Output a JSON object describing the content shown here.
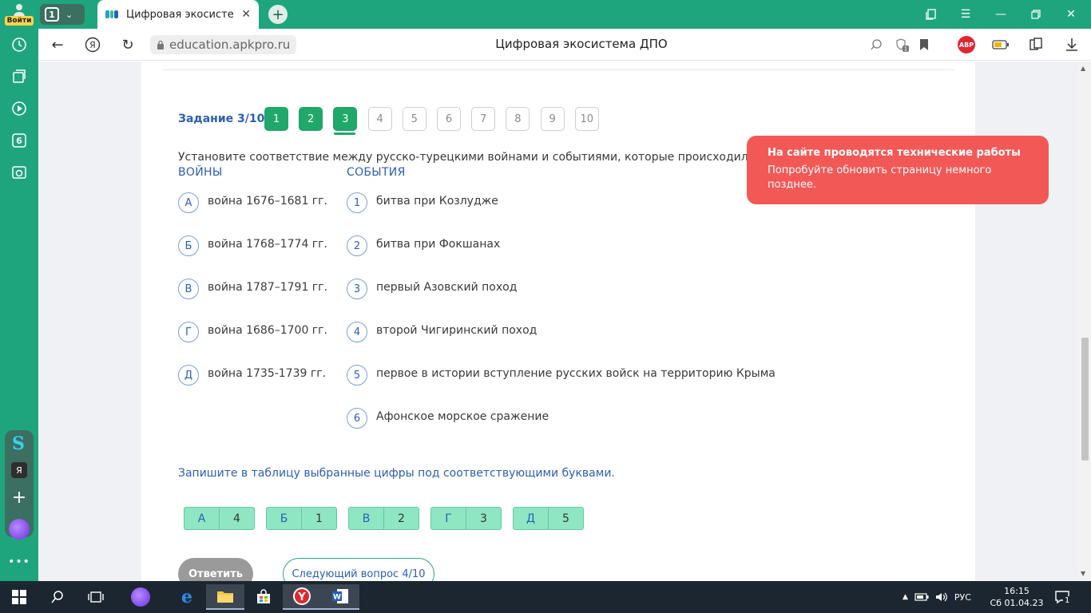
{
  "browser": {
    "profile_label": "Войти",
    "tab_count": "1",
    "tab_title": "Цифровая экосистема ДПО",
    "url": "education.apkpro.ru",
    "page_title": "Цифровая экосистема ДПО",
    "abp_label": "ABP",
    "accent": "#1fa57d"
  },
  "sidebar": {
    "badge_number": "6",
    "letter_s": "S",
    "letter_ya": "Я"
  },
  "quiz": {
    "task_label": "Задание 3/10",
    "questions": [
      "1",
      "2",
      "3",
      "4",
      "5",
      "6",
      "7",
      "8",
      "9",
      "10"
    ],
    "completed_count": 3,
    "current": "3",
    "prompt": "Установите соответствие между русско-турецкими войнами и событиями, которые происходили в х",
    "col_left_title": "ВОЙНЫ",
    "col_right_title": "СОБЫТИЯ",
    "wars": [
      {
        "letter": "А",
        "text": "война 1676–1681 гг."
      },
      {
        "letter": "Б",
        "text": "война 1768–1774 гг."
      },
      {
        "letter": "В",
        "text": "война 1787–1791 гг."
      },
      {
        "letter": "Г",
        "text": "война 1686–1700 гг."
      },
      {
        "letter": "Д",
        "text": "война 1735-1739 гг."
      }
    ],
    "events": [
      {
        "num": "1",
        "text": "битва при Козлудже"
      },
      {
        "num": "2",
        "text": "битва при Фокшанах"
      },
      {
        "num": "3",
        "text": "первый Азовский поход"
      },
      {
        "num": "4",
        "text": "второй Чигиринский поход"
      },
      {
        "num": "5",
        "text": "первое в истории вступление русских войск на территорию Крыма"
      },
      {
        "num": "6",
        "text": "Афонское морское сражение"
      }
    ],
    "instruction": "Запишите в таблицу выбранные цифры под соответствующими буквами.",
    "answers": [
      {
        "letter": "А",
        "value": "4"
      },
      {
        "letter": "Б",
        "value": "1"
      },
      {
        "letter": "В",
        "value": "2"
      },
      {
        "letter": "Г",
        "value": "3"
      },
      {
        "letter": "Д",
        "value": "5"
      }
    ],
    "answer_button": "Ответить",
    "next_button": "Следующий вопрос 4/10",
    "done_color": "#1fa86a",
    "link_color": "#2b5fb4"
  },
  "toast": {
    "title": "На сайте проводятся технические работы",
    "message": "Попробуйте обновить страницу немного позднее.",
    "color": "#f15856"
  },
  "taskbar": {
    "language": "РУС",
    "time": "16:15",
    "date": "Сб 01.04.23",
    "notification_count": "1"
  }
}
